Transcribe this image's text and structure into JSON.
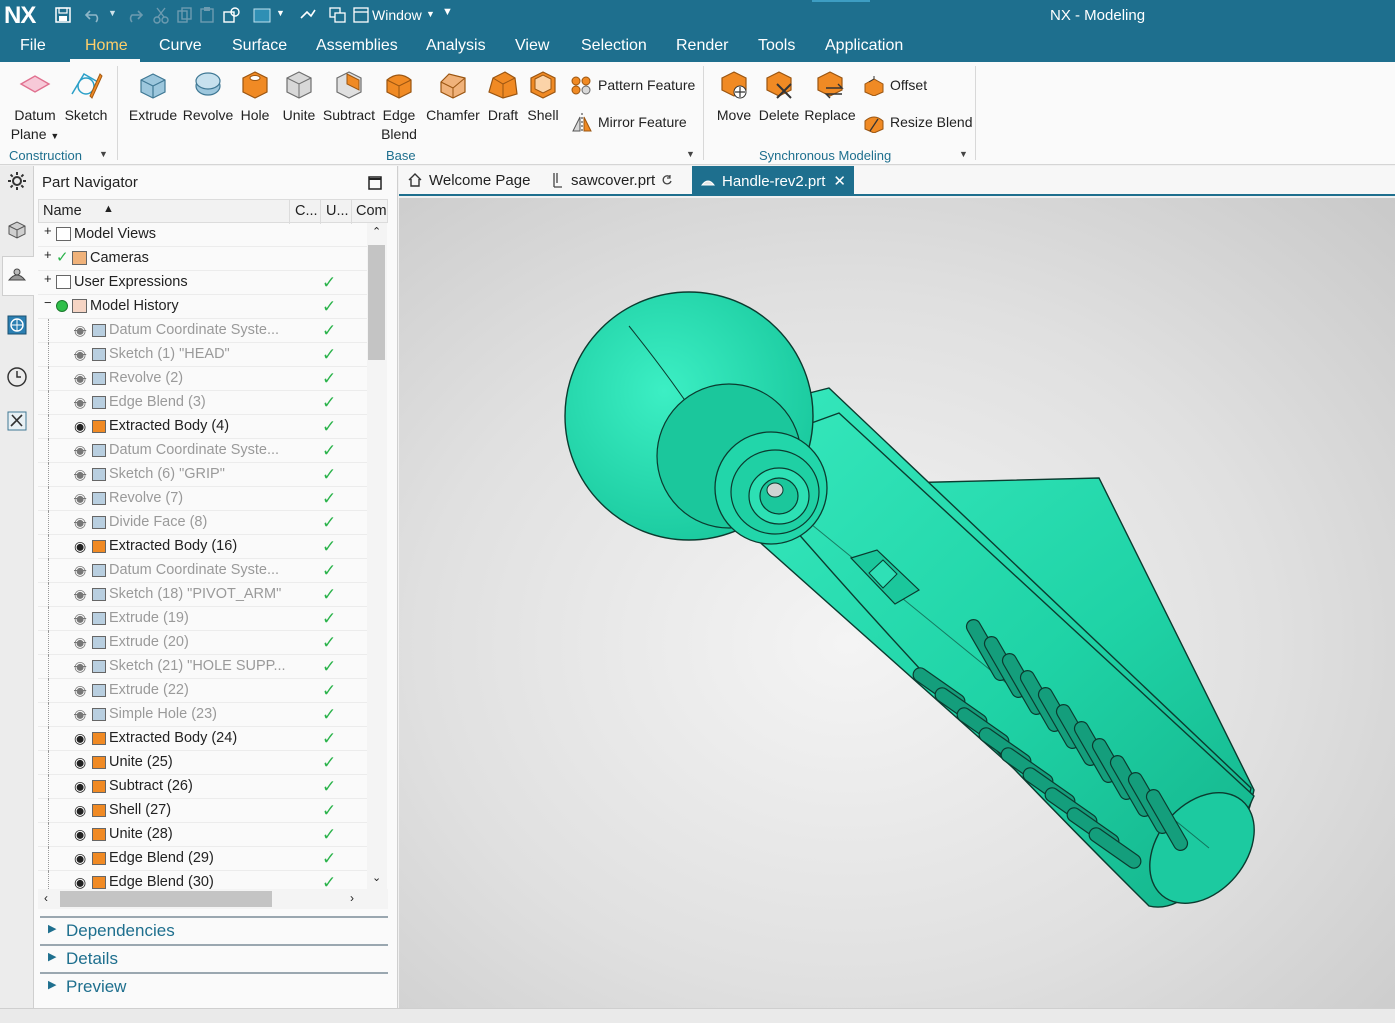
{
  "app": {
    "logo": "NX",
    "window_label": "Window",
    "title": "NX - Modeling"
  },
  "menu": [
    "File",
    "Home",
    "Curve",
    "Surface",
    "Assemblies",
    "Analysis",
    "View",
    "Selection",
    "Render",
    "Tools",
    "Application"
  ],
  "ribbon": {
    "construction": {
      "datum_plane_line1": "Datum",
      "datum_plane_line2": "Plane",
      "sketch": "Sketch",
      "group_label": "Construction"
    },
    "base": {
      "extrude": "Extrude",
      "revolve": "Revolve",
      "hole": "Hole",
      "unite": "Unite",
      "subtract": "Subtract",
      "edge_blend_line1": "Edge",
      "edge_blend_line2": "Blend",
      "chamfer": "Chamfer",
      "draft": "Draft",
      "shell": "Shell",
      "pattern_feature": "Pattern Feature",
      "mirror_feature": "Mirror Feature",
      "group_label": "Base"
    },
    "sync": {
      "move": "Move",
      "delete": "Delete",
      "replace": "Replace",
      "offset": "Offset",
      "resize_blend": "Resize Blend",
      "group_label": "Synchronous Modeling"
    }
  },
  "navigator": {
    "title": "Part Navigator",
    "columns": {
      "name": "Name",
      "c": "C...",
      "u": "U...",
      "com": "Com"
    },
    "top_nodes": [
      {
        "label": "Model Views",
        "checked": false
      },
      {
        "label": "Cameras",
        "checked": false
      },
      {
        "label": "User Expressions",
        "checked": true
      },
      {
        "label": "Model History",
        "checked": true
      }
    ],
    "features": [
      {
        "label": "Datum Coordinate Syste...",
        "hidden": true
      },
      {
        "label": "Sketch (1) \"HEAD\"",
        "hidden": true
      },
      {
        "label": "Revolve (2)",
        "hidden": true
      },
      {
        "label": "Edge Blend (3)",
        "hidden": true
      },
      {
        "label": "Extracted Body (4)",
        "hidden": false
      },
      {
        "label": "Datum Coordinate Syste...",
        "hidden": true
      },
      {
        "label": "Sketch (6) \"GRIP\"",
        "hidden": true
      },
      {
        "label": "Revolve (7)",
        "hidden": true
      },
      {
        "label": "Divide Face (8)",
        "hidden": true
      },
      {
        "label": "Extracted Body (16)",
        "hidden": false
      },
      {
        "label": "Datum Coordinate Syste...",
        "hidden": true
      },
      {
        "label": "Sketch (18) \"PIVOT_ARM\"",
        "hidden": true
      },
      {
        "label": "Extrude (19)",
        "hidden": true
      },
      {
        "label": "Extrude (20)",
        "hidden": true
      },
      {
        "label": "Sketch (21) \"HOLE SUPP...",
        "hidden": true
      },
      {
        "label": "Extrude (22)",
        "hidden": true
      },
      {
        "label": "Simple Hole (23)",
        "hidden": true
      },
      {
        "label": "Extracted Body (24)",
        "hidden": false
      },
      {
        "label": "Unite (25)",
        "hidden": false
      },
      {
        "label": "Subtract (26)",
        "hidden": false
      },
      {
        "label": "Shell (27)",
        "hidden": false
      },
      {
        "label": "Unite (28)",
        "hidden": false
      },
      {
        "label": "Edge Blend (29)",
        "hidden": false
      },
      {
        "label": "Edge Blend (30)",
        "hidden": false
      }
    ],
    "sections": [
      "Dependencies",
      "Details",
      "Preview"
    ]
  },
  "tabs": [
    {
      "label": "Welcome Page",
      "active": false
    },
    {
      "label": "sawcover.prt",
      "active": false
    },
    {
      "label": "Handle-rev2.prt",
      "active": true
    }
  ],
  "colors": {
    "brand": "#1e6f8e",
    "model": "#1fd3a6",
    "check": "#2bb34b",
    "ribbon_icon_orange": "#f08a24"
  }
}
